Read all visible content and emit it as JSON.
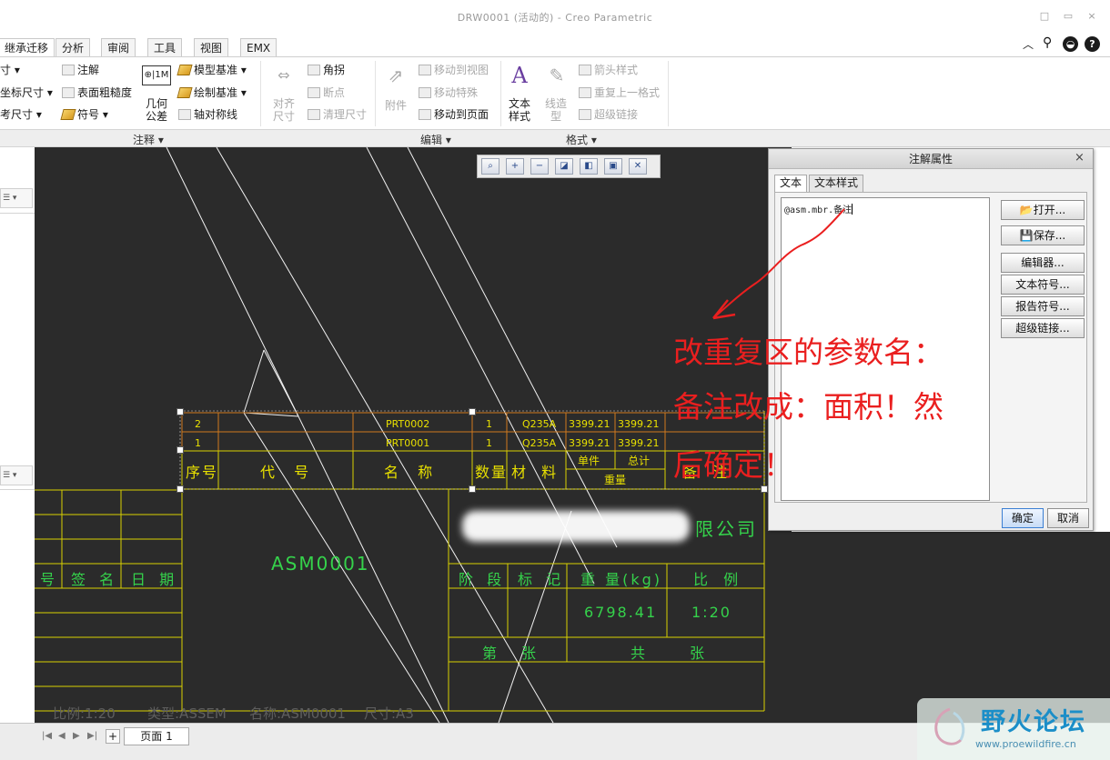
{
  "window": {
    "title": "DRW0001 (活动的) - Creo Parametric",
    "controls": [
      "□",
      "▭",
      "×"
    ]
  },
  "tabs": [
    "继承迁移",
    "分析",
    "审阅",
    "工具",
    "视图",
    "EMX"
  ],
  "ribbon": {
    "col1": [
      "寸 ▾",
      "坐标尺寸 ▾",
      "考尺寸 ▾"
    ],
    "col2": [
      "注解",
      "表面粗糙度",
      "符号 ▾"
    ],
    "col3_big": "几何\n公差",
    "col4": [
      "模型基准 ▾",
      "绘制基准 ▾",
      "轴对称线"
    ],
    "align_big": "对齐\n尺寸",
    "col5": [
      "角拐",
      "断点",
      "清理尺寸"
    ],
    "attach_big": "附件",
    "col6": [
      "移动到视图",
      "移动特殊",
      "移动到页面"
    ],
    "text_style_big": "文本\n样式",
    "line_style_big": "线造\n型",
    "col7": [
      "箭头样式",
      "重复上一格式",
      "超级链接"
    ],
    "groups": [
      "注释 ▾",
      "编辑 ▾",
      "格式 ▾"
    ]
  },
  "drawing": {
    "rows": [
      {
        "no": "2",
        "code": "",
        "name": "PRT0002",
        "qty": "1",
        "material": "Q235A",
        "unit": "3399.21",
        "total": "3399.21"
      },
      {
        "no": "1",
        "code": "",
        "name": "PRT0001",
        "qty": "1",
        "material": "Q235A",
        "unit": "3399.21",
        "total": "3399.21"
      }
    ],
    "header": {
      "no": "序号",
      "code": "代 号",
      "name": "名 称",
      "qty": "数量",
      "material": "材 料",
      "unit": "单件",
      "total": "总计",
      "weight": "重量",
      "note": "备 注"
    },
    "asm_name": "ASM0001",
    "company_suffix": "限公司",
    "left_titles": [
      "号",
      "签 名",
      "日 期"
    ],
    "stage_labels": [
      "阶 段",
      "标 记",
      "重 量(kg)",
      "比 例"
    ],
    "weight_value": "6798.41",
    "scale_value": "1:20",
    "sheet_labels": [
      "第",
      "张",
      "共",
      "张"
    ],
    "status_line": [
      "比例:1:20",
      "类型:ASSEM",
      "名称:ASM0001",
      "尺寸:A3"
    ]
  },
  "dialog": {
    "title": "注解属性",
    "tabs": [
      "文本",
      "文本样式"
    ],
    "text_value": "@asm.mbr.备注",
    "buttons": [
      "打开...",
      "保存...",
      "编辑器...",
      "文本符号...",
      "报告符号...",
      "超级链接..."
    ],
    "ok": "确定",
    "cancel": "取消"
  },
  "annotation": {
    "lines": [
      "改重复区的参数名：",
      "备注改成：面积！然",
      "后确定！"
    ],
    "color": "#ea1f1f"
  },
  "bottom": {
    "page_tab": "页面 1",
    "add": "+"
  },
  "watermark": {
    "name": "野火论坛",
    "url": "www.proewildfire.cn"
  }
}
